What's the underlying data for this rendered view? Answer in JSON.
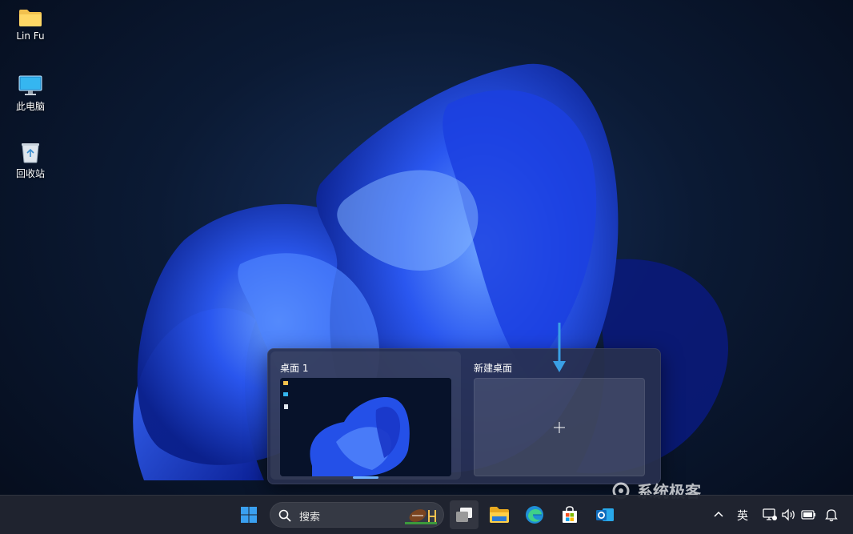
{
  "desktop": {
    "icons": [
      {
        "label": "Lin Fu",
        "icon": "folder-icon"
      },
      {
        "label": "此电脑",
        "icon": "monitor-icon"
      },
      {
        "label": "回收站",
        "icon": "recycle-bin-icon"
      }
    ]
  },
  "task_view": {
    "desktops": [
      {
        "title": "桌面 1",
        "active": true
      },
      {
        "title": "新建桌面",
        "action": "add"
      }
    ]
  },
  "watermark": "系统极客",
  "taskbar": {
    "search_label": "搜索",
    "apps": [
      "start-icon",
      "task-view-icon",
      "file-explorer-icon",
      "edge-icon",
      "store-icon",
      "outlook-icon"
    ],
    "tray": {
      "ime_label": "英",
      "icons": [
        "chevron-up-icon",
        "network-icon",
        "volume-icon",
        "battery-icon",
        "notification-bell-icon"
      ]
    }
  },
  "colors": {
    "accent": "#6fb3ff",
    "taskbar_bg": "#20242f",
    "arrow": "#3aa0e6"
  }
}
